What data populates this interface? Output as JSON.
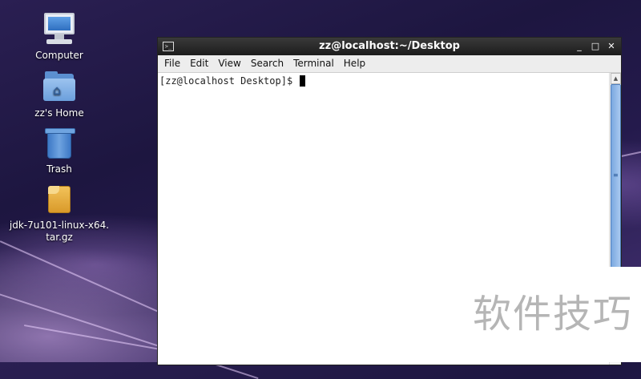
{
  "desktop": {
    "icons": [
      {
        "label": "Computer",
        "icon": "computer-icon"
      },
      {
        "label": "zz's Home",
        "icon": "home-folder-icon"
      },
      {
        "label": "Trash",
        "icon": "trash-icon"
      },
      {
        "label": "jdk-7u101-linux-x64.\ntar.gz",
        "icon": "archive-icon"
      }
    ]
  },
  "window": {
    "title": "zz@localhost:~/Desktop",
    "icon": "terminal-icon",
    "controls": {
      "minimize": "_",
      "maximize": "□",
      "close": "✕"
    },
    "menu": [
      "File",
      "Edit",
      "View",
      "Search",
      "Terminal",
      "Help"
    ],
    "terminal": {
      "prompt": "[zz@localhost Desktop]$ "
    }
  },
  "watermark": "软件技巧",
  "colors": {
    "titlebar": "#1c1c1c",
    "scrollbar_thumb": "#7aa8e0"
  }
}
